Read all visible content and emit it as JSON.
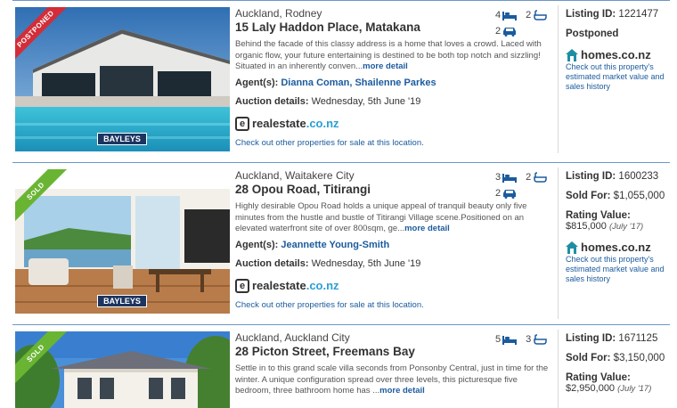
{
  "listings": [
    {
      "ribbon": "POSTPONED",
      "ribbon_color": "#d22d38",
      "agency": "BAYLEYS",
      "suburb": "Auckland, Rodney",
      "address": "15 Laly Haddon Place, Matakana",
      "bedrooms": "4",
      "bathrooms": "2",
      "garages": "2",
      "description": "Behind the facade of this classy address is a home that loves a crowd. Laced with organic flow, your future entertaining is destined to be both top notch and sizzling! Situated in an inherently conven...",
      "more_label": "more detail",
      "agents_label": "Agent(s):",
      "agents": "Dianna Coman, Shailenne Parkes",
      "auction_label": "Auction details:",
      "auction_date": "Wednesday, 5th June '19",
      "re_word": "realestate",
      "re_tld": ".co.nz",
      "check_location": "Check out other properties for sale at this location.",
      "listing_id_label": "Listing ID:",
      "listing_id": "1221477",
      "status": "Postponed",
      "homes_word": "homes.co.nz",
      "homes_link": "Check out this property's estimated market value and sales history"
    },
    {
      "ribbon": "SOLD",
      "ribbon_color": "#69b533",
      "agency": "BAYLEYS",
      "suburb": "Auckland, Waitakere City",
      "address": "28 Opou Road, Titirangi",
      "bedrooms": "3",
      "bathrooms": "2",
      "garages": "2",
      "description": "Highly desirable Opou Road holds a unique appeal of tranquil beauty only five minutes from the hustle and bustle of Titirangi Village scene.Positioned on an elevated waterfront site of over 800sqm, ge...",
      "more_label": "more detail",
      "agents_label": "Agent(s):",
      "agents": "Jeannette Young-Smith",
      "auction_label": "Auction details:",
      "auction_date": "Wednesday, 5th June '19",
      "re_word": "realestate",
      "re_tld": ".co.nz",
      "check_location": "Check out other properties for sale at this location.",
      "listing_id_label": "Listing ID:",
      "listing_id": "1600233",
      "sold_label": "Sold For:",
      "sold_price": "$1,055,000",
      "rating_label": "Rating Value:",
      "rating_value": "$815,000",
      "rating_date": "(July '17)",
      "homes_word": "homes.co.nz",
      "homes_link": "Check out this property's estimated market value and sales history"
    },
    {
      "ribbon": "SOLD",
      "ribbon_color": "#69b533",
      "suburb": "Auckland, Auckland City",
      "address": "28 Picton Street, Freemans Bay",
      "bedrooms": "5",
      "bathrooms": "3",
      "description": "Settle in to this grand scale villa seconds from Ponsonby Central, just in time for the winter. A unique configuration spread over three levels, this picturesque five bedroom, three bathroom home has ...",
      "more_label": "more detail",
      "listing_id_label": "Listing ID:",
      "listing_id": "1671125",
      "sold_label": "Sold For:",
      "sold_price": "$3,150,000",
      "rating_label": "Rating Value:",
      "rating_value": "$2,950,000",
      "rating_date": "(July '17)"
    }
  ],
  "icons": {
    "bed": "bed-icon",
    "bath": "bath-icon",
    "garage": "garage-icon",
    "house": "house-icon"
  },
  "colors": {
    "link": "#1b5b9e",
    "divider": "#6b97c6",
    "brand_blue": "#2a9fd6",
    "homes_teal": "#1e8fa3"
  }
}
